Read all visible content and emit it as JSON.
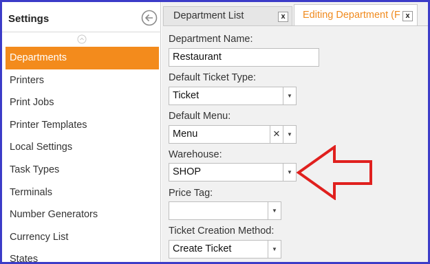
{
  "sidebar": {
    "title": "Settings",
    "items": [
      {
        "label": "Departments",
        "active": true
      },
      {
        "label": "Printers"
      },
      {
        "label": "Print Jobs"
      },
      {
        "label": "Printer Templates"
      },
      {
        "label": "Local Settings"
      },
      {
        "label": "Task Types"
      },
      {
        "label": "Terminals"
      },
      {
        "label": "Number Generators"
      },
      {
        "label": "Currency List"
      },
      {
        "label": "States"
      }
    ]
  },
  "tabs": {
    "list_label": "Department List",
    "edit_label": "Editing Department (F",
    "close_glyph": "x"
  },
  "form": {
    "name_label": "Department Name:",
    "name_value": "Restaurant",
    "ticket_type_label": "Default Ticket Type:",
    "ticket_type_value": "Ticket",
    "menu_label": "Default Menu:",
    "menu_value": "Menu",
    "warehouse_label": "Warehouse:",
    "warehouse_value": "SHOP",
    "price_tag_label": "Price Tag:",
    "price_tag_value": "",
    "creation_label": "Ticket Creation Method:",
    "creation_value": "Create Ticket"
  },
  "colors": {
    "accent": "#f38b1c",
    "annotation_arrow": "#e0201e",
    "frame": "#3c3cc8"
  }
}
